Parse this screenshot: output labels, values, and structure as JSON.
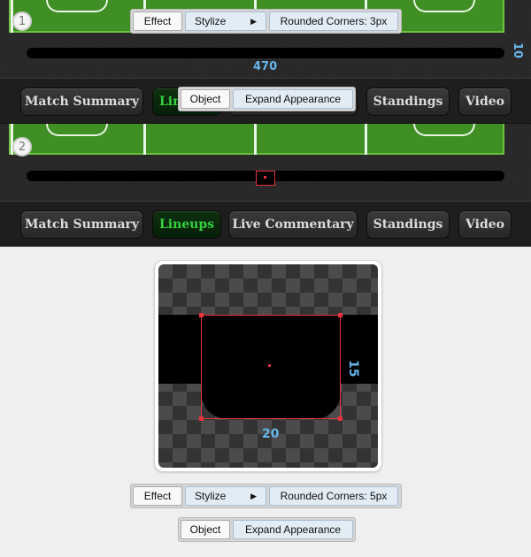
{
  "steps": [
    {
      "number": "1",
      "bar_width_label": "470",
      "bar_height_label": "10",
      "effect_menu": {
        "effect": "Effect",
        "stylize": "Stylize",
        "rounded": "Rounded Corners: 3px"
      },
      "object_menu": {
        "object": "Object",
        "expand": "Expand Appearance"
      }
    },
    {
      "number": "2"
    }
  ],
  "nav_tabs": [
    "Match Summary",
    "Lineups",
    "Live Commentary",
    "Standings",
    "Video"
  ],
  "active_tab": "Lineups",
  "zoom": {
    "width_label": "20",
    "height_label": "15",
    "effect_menu": {
      "effect": "Effect",
      "stylize": "Stylize",
      "rounded": "Rounded Corners: 5px"
    },
    "object_menu": {
      "object": "Object",
      "expand": "Expand Appearance"
    }
  },
  "colors": {
    "pitch": "#3f8f25",
    "active_tab_text": "#35d33f",
    "dimension_labels": "#67b6ea",
    "anchor": "#e8333e"
  }
}
